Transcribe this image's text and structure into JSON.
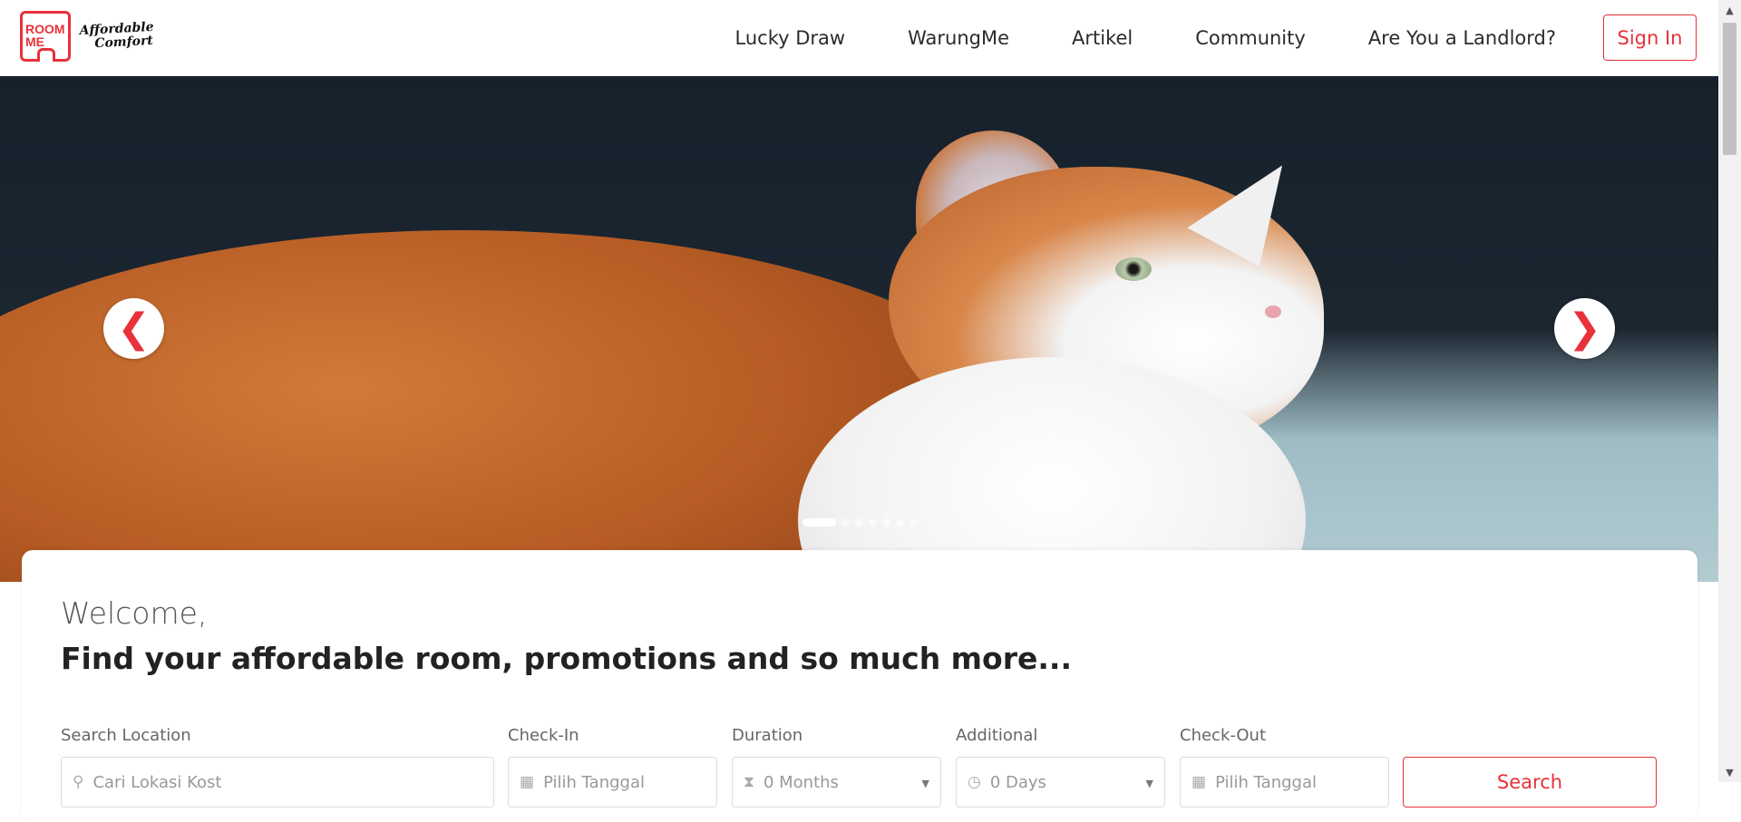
{
  "logo": {
    "box_text_line1": "ROOM",
    "box_text_line2": "ME",
    "tagline_line1": "Affordable",
    "tagline_line2": "Comfort"
  },
  "nav": {
    "items": [
      {
        "label": "Lucky Draw"
      },
      {
        "label": "WarungMe"
      },
      {
        "label": "Artikel"
      },
      {
        "label": "Community"
      },
      {
        "label": "Are You a Landlord?"
      }
    ],
    "sign_in": "Sign In"
  },
  "hero": {
    "slide_count": 7,
    "active_slide": 1,
    "prev_glyph": "❮",
    "next_glyph": "❯"
  },
  "welcome": {
    "greeting": "Welcome,",
    "headline": "Find your affordable room, promotions and so much more..."
  },
  "search_form": {
    "location": {
      "label": "Search Location",
      "placeholder": "Cari Lokasi Kost"
    },
    "check_in": {
      "label": "Check-In",
      "placeholder": "Pilih Tanggal"
    },
    "duration": {
      "label": "Duration",
      "value": "0 Months"
    },
    "additional": {
      "label": "Additional",
      "value": "0 Days"
    },
    "check_out": {
      "label": "Check-Out",
      "placeholder": "Pilih Tanggal"
    },
    "search_button": "Search"
  },
  "colors": {
    "accent": "#e8313b"
  }
}
